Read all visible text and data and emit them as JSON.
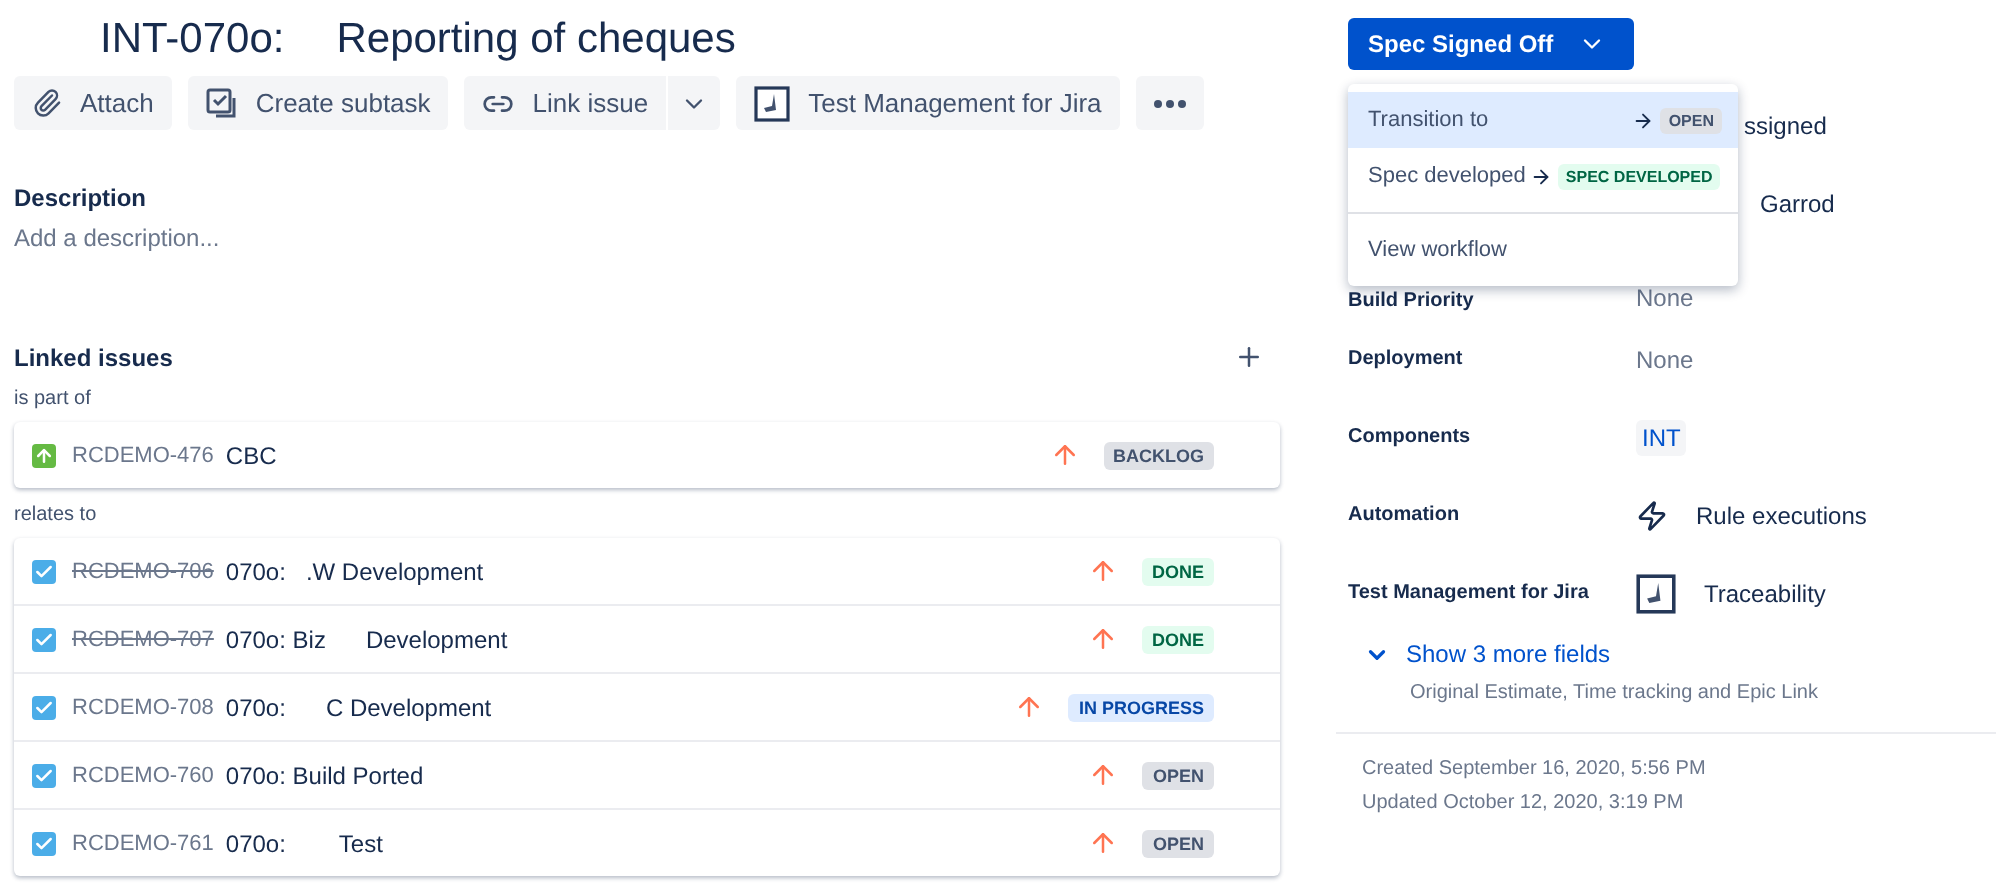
{
  "issue": {
    "key": "INT-070o:",
    "title": "Reporting of cheques"
  },
  "toolbar": [
    {
      "kind": "attach",
      "label": "Attach"
    },
    {
      "kind": "subtask",
      "label": "Create subtask"
    },
    {
      "kind": "link",
      "label": "Link issue"
    },
    {
      "kind": "app",
      "label": "Test Management for Jira"
    },
    {
      "kind": "more"
    }
  ],
  "description": {
    "heading": "Description",
    "placeholder": "Add a description..."
  },
  "linked_issues": {
    "heading": "Linked issues",
    "groups": [
      {
        "relation": "is part of",
        "issues": [
          {
            "kind": "story",
            "key": "RCDEMO-476",
            "resolved": false,
            "summary": "CBC",
            "status": "BACKLOG",
            "color": "#42526e"
          }
        ]
      },
      {
        "relation": "relates to",
        "issues": [
          {
            "kind": "task",
            "key": "RCDEMO-706",
            "resolved": true,
            "summary": "070o:   .W Development",
            "status": "DONE",
            "color": "#006644"
          },
          {
            "kind": "task",
            "key": "RCDEMO-707",
            "resolved": true,
            "summary": "070o: Biz      Development",
            "status": "DONE",
            "color": "#006644"
          },
          {
            "kind": "task",
            "key": "RCDEMO-708",
            "resolved": false,
            "summary": "070o:      C Development",
            "status": "IN PROGRESS",
            "color": "#0747a6"
          },
          {
            "kind": "task",
            "key": "RCDEMO-760",
            "resolved": false,
            "summary": "070o: Build Ported",
            "status": "OPEN",
            "color": "#42526e"
          },
          {
            "kind": "task",
            "key": "RCDEMO-761",
            "resolved": false,
            "summary": "070o:        Test",
            "status": "OPEN",
            "color": "#42526e"
          }
        ]
      }
    ]
  },
  "status_button": {
    "label": "Spec Signed Off"
  },
  "status_menu": {
    "items": [
      {
        "kind": "transition",
        "label": "Transition to",
        "status": "OPEN",
        "color": "#42526e",
        "selected": true
      },
      {
        "kind": "transition",
        "label": "Spec developed",
        "status": "SPEC DEVELOPED",
        "color": "#006644",
        "selected": false
      },
      {
        "kind": "divider"
      },
      {
        "kind": "action",
        "label": "View workflow",
        "selected": false
      }
    ]
  },
  "fields": [
    {
      "kind": "text",
      "value": "ssigned"
    },
    {
      "kind": "text",
      "value": "Garrod"
    },
    {
      "kind": "text",
      "label": "Build Priority",
      "value": "None"
    },
    {
      "kind": "text",
      "label": "Deployment",
      "value": "None"
    },
    {
      "kind": "tag",
      "label": "Components",
      "value": "INT"
    },
    {
      "kind": "automation",
      "label": "Automation",
      "value": "Rule executions"
    },
    {
      "kind": "app",
      "label": "Test Management for Jira",
      "value": "Traceability"
    }
  ],
  "more_fields": {
    "label": "Show 3 more fields",
    "hint": "Original Estimate, Time tracking and Epic Link"
  },
  "dates": [
    "Created September 16, 2020, 5:56 PM",
    "Updated October 12, 2020, 3:19 PM"
  ]
}
